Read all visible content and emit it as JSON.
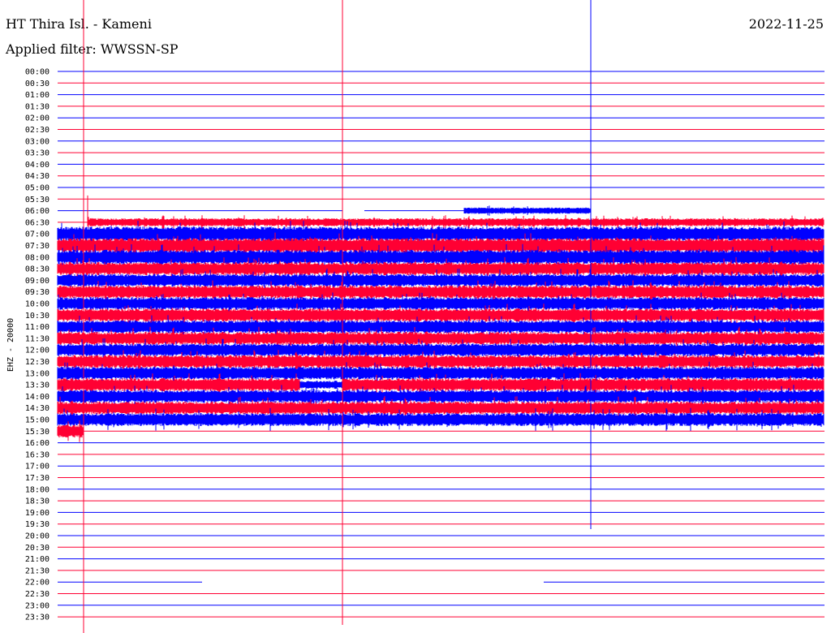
{
  "header": {
    "station": "HT Thira Isl. - Kameni",
    "filter": "Applied filter: WWSSN-SP",
    "date": "2022-11-25"
  },
  "chart_data": {
    "type": "helicorder",
    "ylabel": "EHZ - 20000",
    "row_interval_minutes": 30,
    "tick_labels": [
      "00:00",
      "00:30",
      "01:00",
      "01:30",
      "02:00",
      "02:30",
      "03:00",
      "03:30",
      "04:00",
      "04:30",
      "05:00",
      "05:30",
      "06:00",
      "06:30",
      "07:00",
      "07:30",
      "08:00",
      "08:30",
      "09:00",
      "09:30",
      "10:00",
      "10:30",
      "11:00",
      "11:30",
      "12:00",
      "12:30",
      "13:00",
      "13:30",
      "14:00",
      "14:30",
      "15:00",
      "15:30",
      "16:00",
      "16:30",
      "17:00",
      "17:30",
      "18:00",
      "18:30",
      "19:00",
      "19:30",
      "20:00",
      "20:30",
      "21:00",
      "21:30",
      "22:00",
      "22:30",
      "23:00",
      "23:30"
    ],
    "row_colors": [
      "#0000ff",
      "#ff0033"
    ],
    "signal_rows_start": "06:30",
    "signal_rows_end": "15:30",
    "grid": false
  }
}
